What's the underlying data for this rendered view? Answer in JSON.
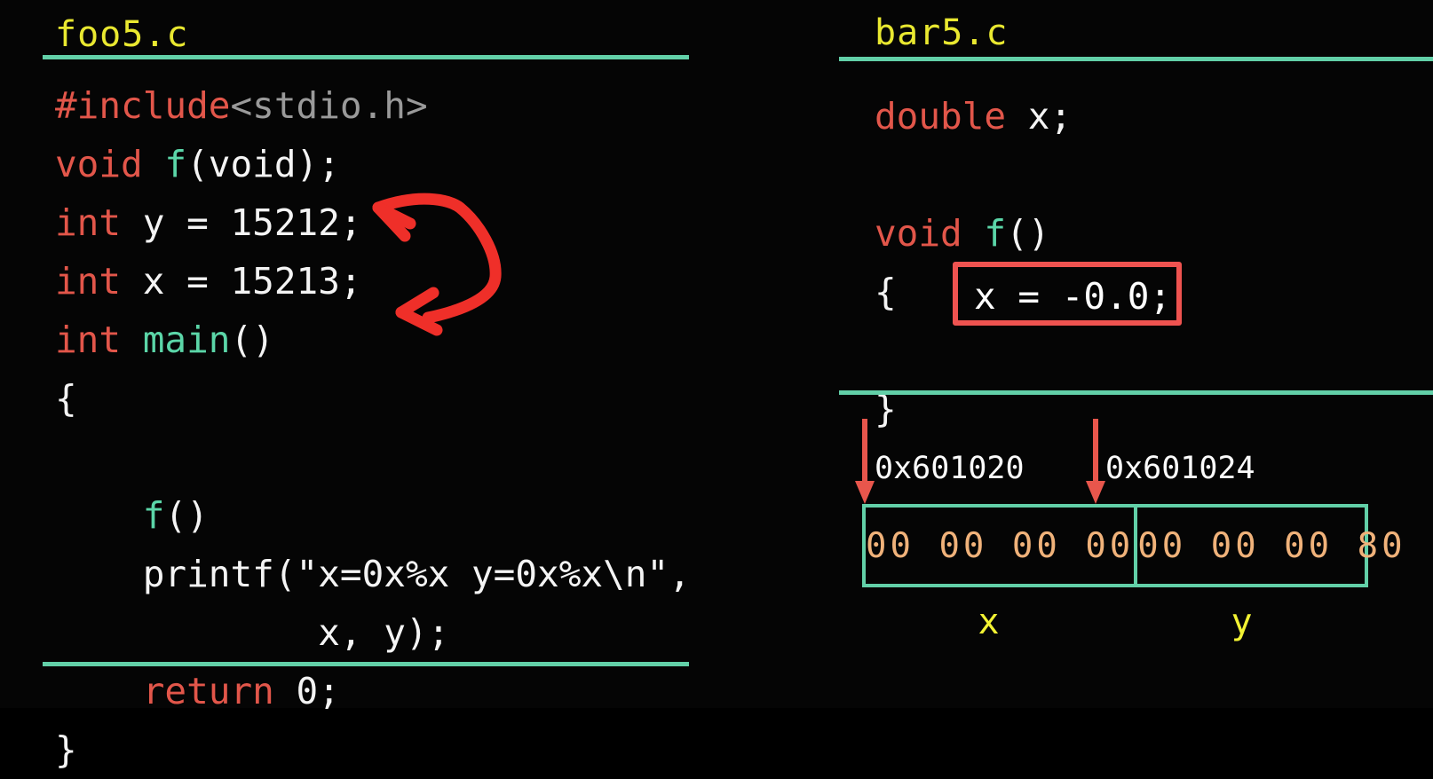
{
  "colors": {
    "background": "#050505",
    "accent_teal": "#62d0a8",
    "title_yellow": "#e9e830",
    "keyword_red": "#e2564a",
    "function_green": "#5bd6a8",
    "header_gray": "#9a9a9a",
    "plain_white": "#f2f2f2",
    "annotation_red": "#ef3a34",
    "arrow_red": "#e8564c",
    "byte_orange": "#f0b27a",
    "label_yellow": "#f2f233"
  },
  "left_panel": {
    "title": "foo5.c",
    "code_lines": [
      {
        "id": "include",
        "tokens": [
          {
            "t": "#include",
            "c": "kw"
          },
          {
            "t": "<stdio.h>",
            "c": "hdr"
          }
        ]
      },
      {
        "id": "void-f-decl",
        "tokens": [
          {
            "t": "void ",
            "c": "kw"
          },
          {
            "t": "f",
            "c": "fn"
          },
          {
            "t": "(void);",
            "c": "pl"
          }
        ]
      },
      {
        "id": "int-y",
        "tokens": [
          {
            "t": "int",
            "c": "kw"
          },
          {
            "t": " y = 15212;",
            "c": "pl"
          }
        ]
      },
      {
        "id": "int-x",
        "tokens": [
          {
            "t": "int",
            "c": "kw"
          },
          {
            "t": " x = 15213;",
            "c": "pl"
          }
        ]
      },
      {
        "id": "int-main",
        "tokens": [
          {
            "t": "int ",
            "c": "kw"
          },
          {
            "t": "main",
            "c": "fn"
          },
          {
            "t": "()",
            "c": "pl"
          }
        ]
      },
      {
        "id": "open-brace",
        "tokens": [
          {
            "t": "{",
            "c": "pl"
          }
        ]
      },
      {
        "id": "blank-1",
        "tokens": [
          {
            "t": " ",
            "c": "pl"
          }
        ]
      },
      {
        "id": "call-f",
        "tokens": [
          {
            "t": "    ",
            "c": "pl"
          },
          {
            "t": "f",
            "c": "fn"
          },
          {
            "t": "()",
            "c": "pl"
          }
        ]
      },
      {
        "id": "printf",
        "tokens": [
          {
            "t": "    printf(\"x=0x%x y=0x%x\\n\",",
            "c": "pl"
          }
        ]
      },
      {
        "id": "printf-args",
        "tokens": [
          {
            "t": "            x, y);",
            "c": "pl"
          }
        ]
      },
      {
        "id": "return",
        "tokens": [
          {
            "t": "    ",
            "c": "pl"
          },
          {
            "t": "return",
            "c": "kw"
          },
          {
            "t": " 0;",
            "c": "pl"
          }
        ]
      },
      {
        "id": "close-brace",
        "tokens": [
          {
            "t": "}",
            "c": "pl"
          }
        ]
      }
    ],
    "annotation": {
      "name": "double-headed-arrow",
      "description": "hand-drawn red double arrow pointing at the int y and int x declarations"
    }
  },
  "right_panel": {
    "title": "bar5.c",
    "code_lines": [
      {
        "id": "double-x",
        "tokens": [
          {
            "t": "double",
            "c": "kw"
          },
          {
            "t": " x;",
            "c": "pl"
          }
        ]
      },
      {
        "id": "blank-a",
        "tokens": [
          {
            "t": " ",
            "c": "pl"
          }
        ]
      },
      {
        "id": "void-f-def",
        "tokens": [
          {
            "t": "void ",
            "c": "kw"
          },
          {
            "t": "f",
            "c": "fn"
          },
          {
            "t": "()",
            "c": "pl"
          }
        ]
      },
      {
        "id": "open-brace-r",
        "tokens": [
          {
            "t": "{",
            "c": "pl"
          }
        ]
      },
      {
        "id": "assign-slot",
        "tokens": [
          {
            "t": " ",
            "c": "pl"
          }
        ]
      },
      {
        "id": "close-brace-r",
        "tokens": [
          {
            "t": "}",
            "c": "pl"
          }
        ]
      }
    ],
    "highlighted_statement": "x = -0.0;",
    "memory": {
      "addresses": [
        "0x601020",
        "0x601024"
      ],
      "cells": [
        {
          "bytes": "00 00 00 00",
          "var": "x"
        },
        {
          "bytes": "00 00 00 80",
          "var": "y"
        }
      ]
    }
  }
}
